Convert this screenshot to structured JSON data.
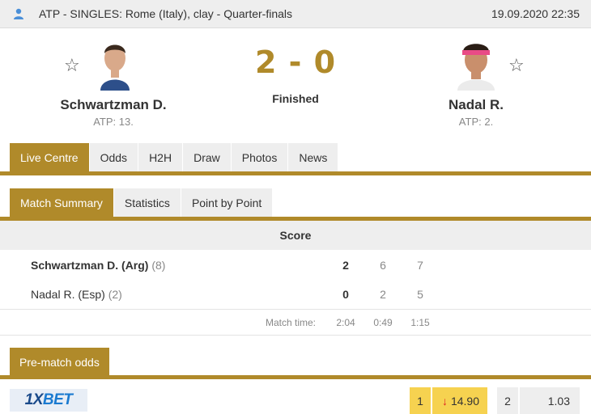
{
  "header": {
    "tournament": "ATP - SINGLES: Rome (Italy), clay - Quarter-finals",
    "datetime": "19.09.2020 22:35"
  },
  "home": {
    "name": "Schwartzman D.",
    "rank": "ATP: 13."
  },
  "away": {
    "name": "Nadal R.",
    "rank": "ATP: 2."
  },
  "match": {
    "score": "2 - 0",
    "status": "Finished"
  },
  "main_tabs": [
    {
      "label": "Live Centre",
      "active": true
    },
    {
      "label": "Odds",
      "active": false
    },
    {
      "label": "H2H",
      "active": false
    },
    {
      "label": "Draw",
      "active": false
    },
    {
      "label": "Photos",
      "active": false
    },
    {
      "label": "News",
      "active": false
    }
  ],
  "sub_tabs": [
    {
      "label": "Match Summary",
      "active": true
    },
    {
      "label": "Statistics",
      "active": false
    },
    {
      "label": "Point by Point",
      "active": false
    }
  ],
  "score_table": {
    "header": "Score",
    "rows": [
      {
        "name": "Schwartzman D. (Arg)",
        "seed": "(8)",
        "bold": true,
        "total": "2",
        "sets": [
          "6",
          "7"
        ]
      },
      {
        "name": "Nadal R. (Esp)",
        "seed": "(2)",
        "bold": false,
        "total": "0",
        "sets": [
          "2",
          "5"
        ]
      }
    ],
    "match_time_label": "Match time:",
    "match_times": [
      "2:04",
      "0:49",
      "1:15"
    ]
  },
  "odds": {
    "section_label": "Pre-match odds",
    "bookmaker": {
      "part1": "1X",
      "part2": "BET"
    },
    "home_label": "1",
    "home_value": "14.90",
    "away_label": "2",
    "away_value": "1.03"
  },
  "colors": {
    "accent": "#b08a2a",
    "highlight": "#f6d250",
    "down": "#d22222"
  }
}
